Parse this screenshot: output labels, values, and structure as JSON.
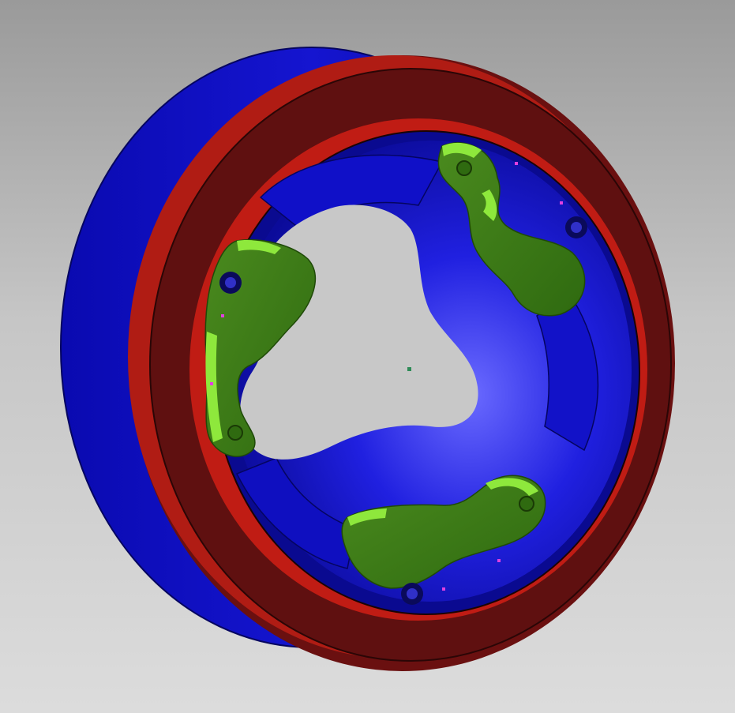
{
  "viewport": {
    "background_top": "#9a9a9a",
    "background_bottom": "#dcdcdc"
  },
  "model": {
    "hub_color": "#1a1ad6",
    "hub_dark": "#0a0a8a",
    "ring_color": "#c41e14",
    "ring_dark": "#5e1010",
    "pawl_color": "#3c7a16",
    "pawl_light": "#8ee83c",
    "point_marker_color": "#e040e0",
    "origin_marker_color": "#2e8b57",
    "pawl_count": 3,
    "lobe_count": 3
  }
}
